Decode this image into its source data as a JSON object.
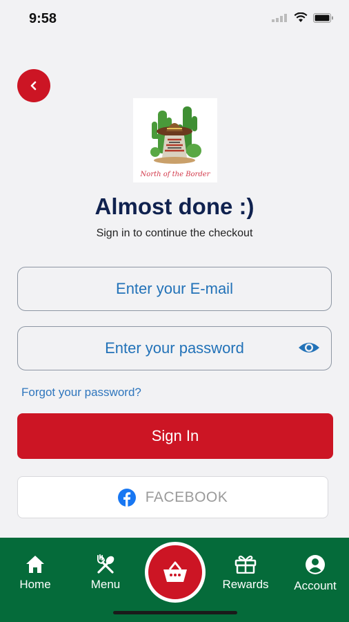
{
  "status_bar": {
    "time": "9:58"
  },
  "logo": {
    "text": "North of the Border"
  },
  "header": {
    "title": "Almost done :)",
    "subtitle": "Sign in to continue the checkout"
  },
  "form": {
    "email_placeholder": "Enter your E-mail",
    "password_placeholder": "Enter your password",
    "forgot_label": "Forgot your password?",
    "signin_label": "Sign In",
    "facebook_label": "FACEBOOK"
  },
  "tabs": [
    {
      "label": "Home",
      "icon": "home-icon"
    },
    {
      "label": "Menu",
      "icon": "utensils-icon"
    },
    {
      "label": "",
      "icon": "basket-icon"
    },
    {
      "label": "Rewards",
      "icon": "gift-icon"
    },
    {
      "label": "Account",
      "icon": "account-icon"
    }
  ],
  "colors": {
    "accent_red": "#cc1524",
    "tab_green": "#056b3a",
    "title_navy": "#10224f",
    "link_blue": "#2f76bd",
    "facebook_blue": "#1877f2"
  }
}
